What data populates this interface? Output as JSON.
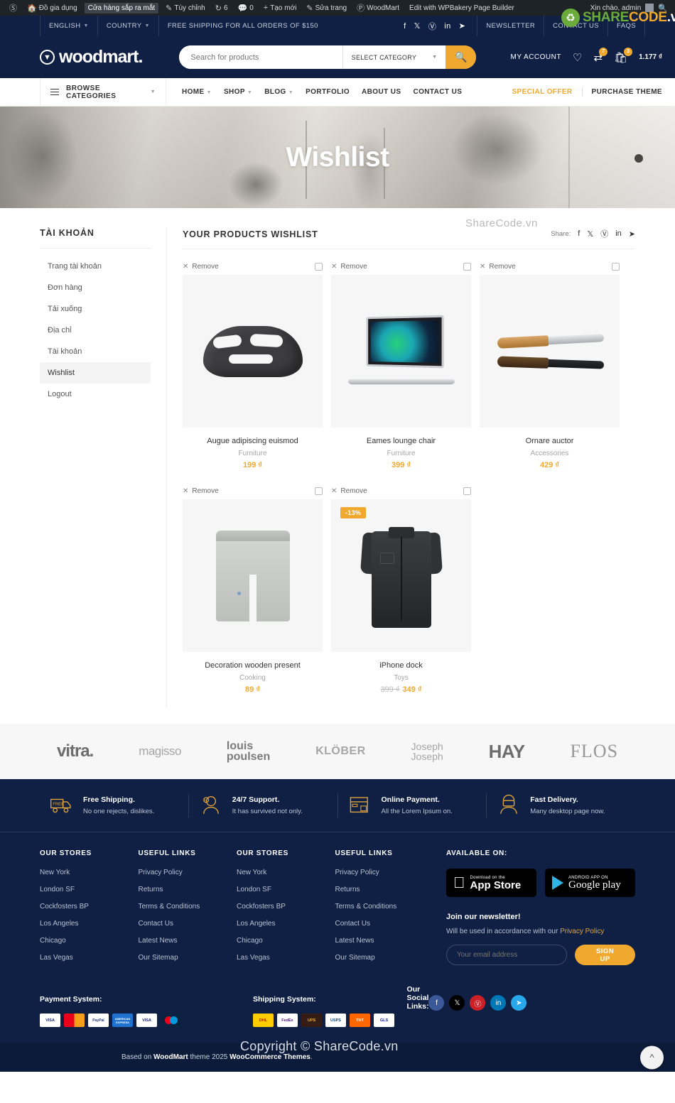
{
  "admin_bar": {
    "items": [
      {
        "icon": "wordpress-icon",
        "label": ""
      },
      {
        "icon": "home-icon",
        "label": "Đồ gia dụng"
      },
      {
        "icon": "",
        "label": "Cửa hàng sắp ra mắt",
        "boxed": true
      },
      {
        "icon": "pencil-icon",
        "label": "Tùy chỉnh"
      },
      {
        "icon": "refresh-icon",
        "label": "6"
      },
      {
        "icon": "comment-icon",
        "label": "0"
      },
      {
        "icon": "plus-icon",
        "label": "Tạo mới"
      },
      {
        "icon": "edit-icon",
        "label": "Sửa trang"
      },
      {
        "icon": "woodmart-icon",
        "label": "WoodMart"
      },
      {
        "icon": "",
        "label": "Edit with WPBakery Page Builder"
      }
    ],
    "greeting": "Xin chào, admin",
    "search_icon": "search-icon"
  },
  "topbar": {
    "language": "ENGLISH",
    "country": "COUNTRY",
    "promo": "FREE SHIPPING FOR ALL ORDERS OF $150",
    "socials": [
      "facebook-icon",
      "x-icon",
      "pinterest-icon",
      "linkedin-icon",
      "telegram-icon"
    ],
    "links": [
      "NEWSLETTER",
      "CONTACT US",
      "FAQS"
    ]
  },
  "header": {
    "brand": "woodmart.",
    "search_placeholder": "Search for products",
    "search_value": "",
    "category_select": "SELECT CATEGORY",
    "my_account": "MY ACCOUNT",
    "wishlist_icon": "heart-icon",
    "compare_icon": "compare-icon",
    "compare_count": "7",
    "cart_icon": "cart-icon",
    "cart_count": "3",
    "cart_total": "1.177 ₫"
  },
  "nav": {
    "browse": "BROWSE CATEGORIES",
    "links": [
      {
        "label": "HOME",
        "caret": true
      },
      {
        "label": "SHOP",
        "caret": true
      },
      {
        "label": "BLOG",
        "caret": true
      },
      {
        "label": "PORTFOLIO",
        "caret": false
      },
      {
        "label": "ABOUT US",
        "caret": false
      },
      {
        "label": "CONTACT US",
        "caret": false
      }
    ],
    "special_offer": "SPECIAL OFFER",
    "purchase_theme": "PURCHASE THEME"
  },
  "hero": {
    "title": "Wishlist"
  },
  "sidebar": {
    "title": "TÀI KHOẢN",
    "items": [
      {
        "label": "Trang tài khoản",
        "active": false
      },
      {
        "label": "Đơn hàng",
        "active": false
      },
      {
        "label": "Tải xuống",
        "active": false
      },
      {
        "label": "Địa chỉ",
        "active": false
      },
      {
        "label": "Tài khoản",
        "active": false
      },
      {
        "label": "Wishlist",
        "active": true
      },
      {
        "label": "Logout",
        "active": false
      }
    ]
  },
  "wishlist": {
    "title": "YOUR PRODUCTS WISHLIST",
    "share_label": "Share:",
    "share_icons": [
      "facebook-icon",
      "x-icon",
      "pinterest-icon",
      "linkedin-icon",
      "telegram-icon"
    ],
    "remove_label": "Remove",
    "products": [
      {
        "name": "Augue adipiscing euismod",
        "category": "Furniture",
        "price": "199 ₫",
        "old_price": "",
        "badge": "",
        "art": "helmet"
      },
      {
        "name": "Eames lounge chair",
        "category": "Furniture",
        "price": "399 ₫",
        "old_price": "",
        "badge": "",
        "art": "laptop"
      },
      {
        "name": "Ornare auctor",
        "category": "Accessories",
        "price": "429 ₫",
        "old_price": "",
        "badge": "",
        "art": "knife"
      },
      {
        "name": "Decoration wooden present",
        "category": "Cooking",
        "price": "89 ₫",
        "old_price": "",
        "badge": "",
        "art": "shorts"
      },
      {
        "name": "iPhone dock",
        "category": "Toys",
        "price": "349 ₫",
        "old_price": "399 ₫",
        "badge": "-13%",
        "art": "shirt"
      }
    ]
  },
  "brands": [
    {
      "name": "vitra.",
      "style": "b-vitra"
    },
    {
      "name": "magisso",
      "style": "b-magisso"
    },
    {
      "name": "louis poulsen",
      "style": "b-louis"
    },
    {
      "name": "KLÖBER",
      "style": "b-klober"
    },
    {
      "name": "Joseph Joseph",
      "style": "b-joseph"
    },
    {
      "name": "HAY",
      "style": "b-hay"
    },
    {
      "name": "FLOS",
      "style": "b-flos"
    }
  ],
  "features": [
    {
      "icon": "truck-icon",
      "title": "Free Shipping.",
      "subtitle": "No one rejects, dislikes."
    },
    {
      "icon": "support-icon",
      "title": "24/7 Support.",
      "subtitle": "It has survived not only."
    },
    {
      "icon": "payment-icon",
      "title": "Online Payment.",
      "subtitle": "All the Lorem Ipsum on."
    },
    {
      "icon": "delivery-icon",
      "title": "Fast Delivery.",
      "subtitle": "Many desktop page now."
    }
  ],
  "footer": {
    "columns": [
      {
        "heading": "OUR STORES",
        "links": [
          "New York",
          "London SF",
          "Cockfosters BP",
          "Los Angeles",
          "Chicago",
          "Las Vegas"
        ]
      },
      {
        "heading": "USEFUL LINKS",
        "links": [
          "Privacy Policy",
          "Returns",
          "Terms & Conditions",
          "Contact Us",
          "Latest News",
          "Our Sitemap"
        ]
      },
      {
        "heading": "OUR STORES",
        "links": [
          "New York",
          "London SF",
          "Cockfosters BP",
          "Los Angeles",
          "Chicago",
          "Las Vegas"
        ]
      },
      {
        "heading": "USEFUL LINKS",
        "links": [
          "Privacy Policy",
          "Returns",
          "Terms & Conditions",
          "Contact Us",
          "Latest News",
          "Our Sitemap"
        ]
      }
    ],
    "available_on": "AVAILABLE ON:",
    "app_store_small": "Download on the",
    "app_store_large": "App Store",
    "google_play_small": "ANDROID APP ON",
    "google_play_large": "Google play",
    "newsletter_title": "Join our newsletter!",
    "newsletter_note_pre": "Will be used in accordance with our ",
    "newsletter_note_link": "Privacy Policy",
    "email_placeholder": "Your email address",
    "email_value": "",
    "signup_label": "SIGN UP",
    "payment_heading": "Payment System:",
    "payment_cards": [
      "VISA",
      "MasterCard",
      "PayPal",
      "AMERICAN EXPRESS",
      "VISA",
      "Maestro"
    ],
    "shipping_heading": "Shipping System:",
    "shipping_carriers": [
      "DHL",
      "FedEx",
      "UPS",
      "USPS",
      "TNT",
      "GLS"
    ],
    "social_heading": "Our Social Links:",
    "socials": [
      "facebook-icon",
      "x-icon",
      "pinterest-icon",
      "linkedin-icon",
      "telegram-icon"
    ],
    "copyright_pre": "Based on ",
    "copyright_b1": "WoodMart",
    "copyright_mid": " theme 2025 ",
    "copyright_b2": "WooCommerce Themes",
    "copyright_end": ".",
    "to_top_icon": "chevron-up-icon"
  },
  "watermarks": {
    "logo_share": "SHARE",
    "logo_code": "CODE",
    "logo_vn": ".vn",
    "center": "ShareCode.vn",
    "copyright": "Copyright © ShareCode.vn"
  },
  "colors": {
    "navy": "#102044",
    "accent": "#f0a92e",
    "muted": "#a5a5a5"
  }
}
